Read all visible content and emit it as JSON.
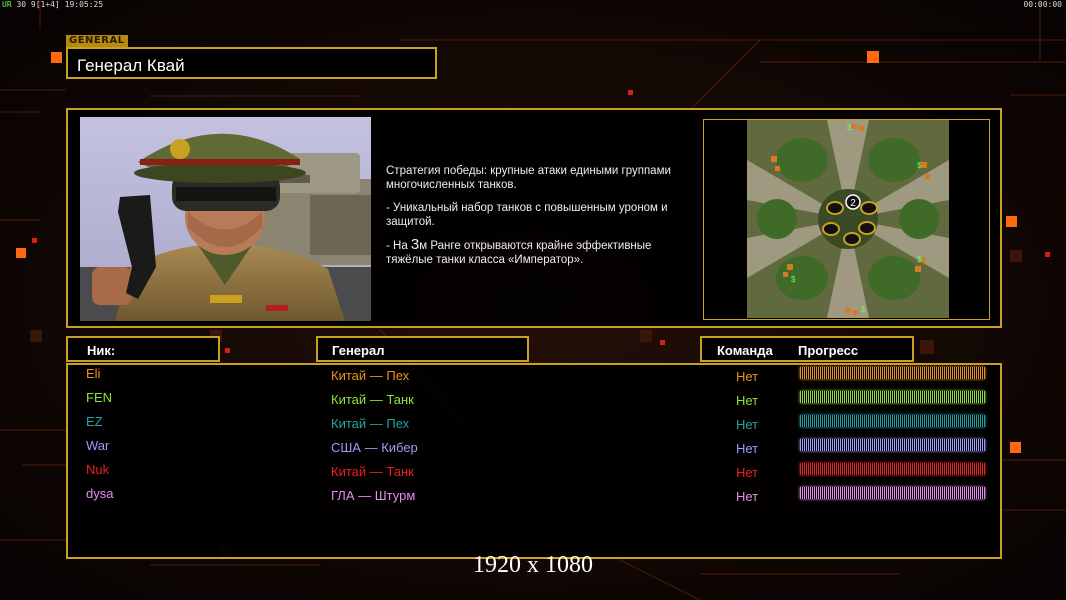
{
  "hud": {
    "top_left_prefix": "UR",
    "top_left_stats": "30 9",
    "top_left_bracket": "[1+4]",
    "top_left_time": "19:05:25",
    "top_right_time": "00:00:00"
  },
  "general_panel": {
    "tag": "GENERAL",
    "title": "Генерал Квай"
  },
  "description": {
    "line1": "Стратегия победы: крупные атаки едиными группами многочисленных танков.",
    "line2": "- Уникальный набор танков с повышенным уроном и защитой.",
    "line3_prefix": "- На ",
    "line3_rank": "3",
    "line3_suffix": "м Ранге открываются крайне эффективные тяжёлые танки класса «Император»."
  },
  "map": {
    "center_label": "2",
    "money_symbol": "$"
  },
  "headers": {
    "nick": "Ник:",
    "general": "Генерал",
    "team": "Команда",
    "progress": "Прогресс"
  },
  "players": [
    {
      "nick": "Eli",
      "general": "Китай — Пех",
      "team": "Нет",
      "color": "#e8921e",
      "progress": 1.0
    },
    {
      "nick": "FEN",
      "general": "Китай — Танк",
      "team": "Нет",
      "color": "#8ee23a",
      "progress": 1.0
    },
    {
      "nick": "EZ",
      "general": "Китай — Пех",
      "team": "Нет",
      "color": "#23a3a8",
      "progress": 1.0
    },
    {
      "nick": "War",
      "general": "США — Кибер",
      "team": "Нет",
      "color": "#9b9bff",
      "progress": 1.0
    },
    {
      "nick": "Nuk",
      "general": "Китай — Танк",
      "team": "Нет",
      "color": "#e82020",
      "progress": 1.0
    },
    {
      "nick": "dysa",
      "general": "ГЛА — Штурм",
      "team": "Нет",
      "color": "#e58cf0",
      "progress": 1.0
    }
  ],
  "footer": {
    "resolution": "1920 x 1080"
  }
}
